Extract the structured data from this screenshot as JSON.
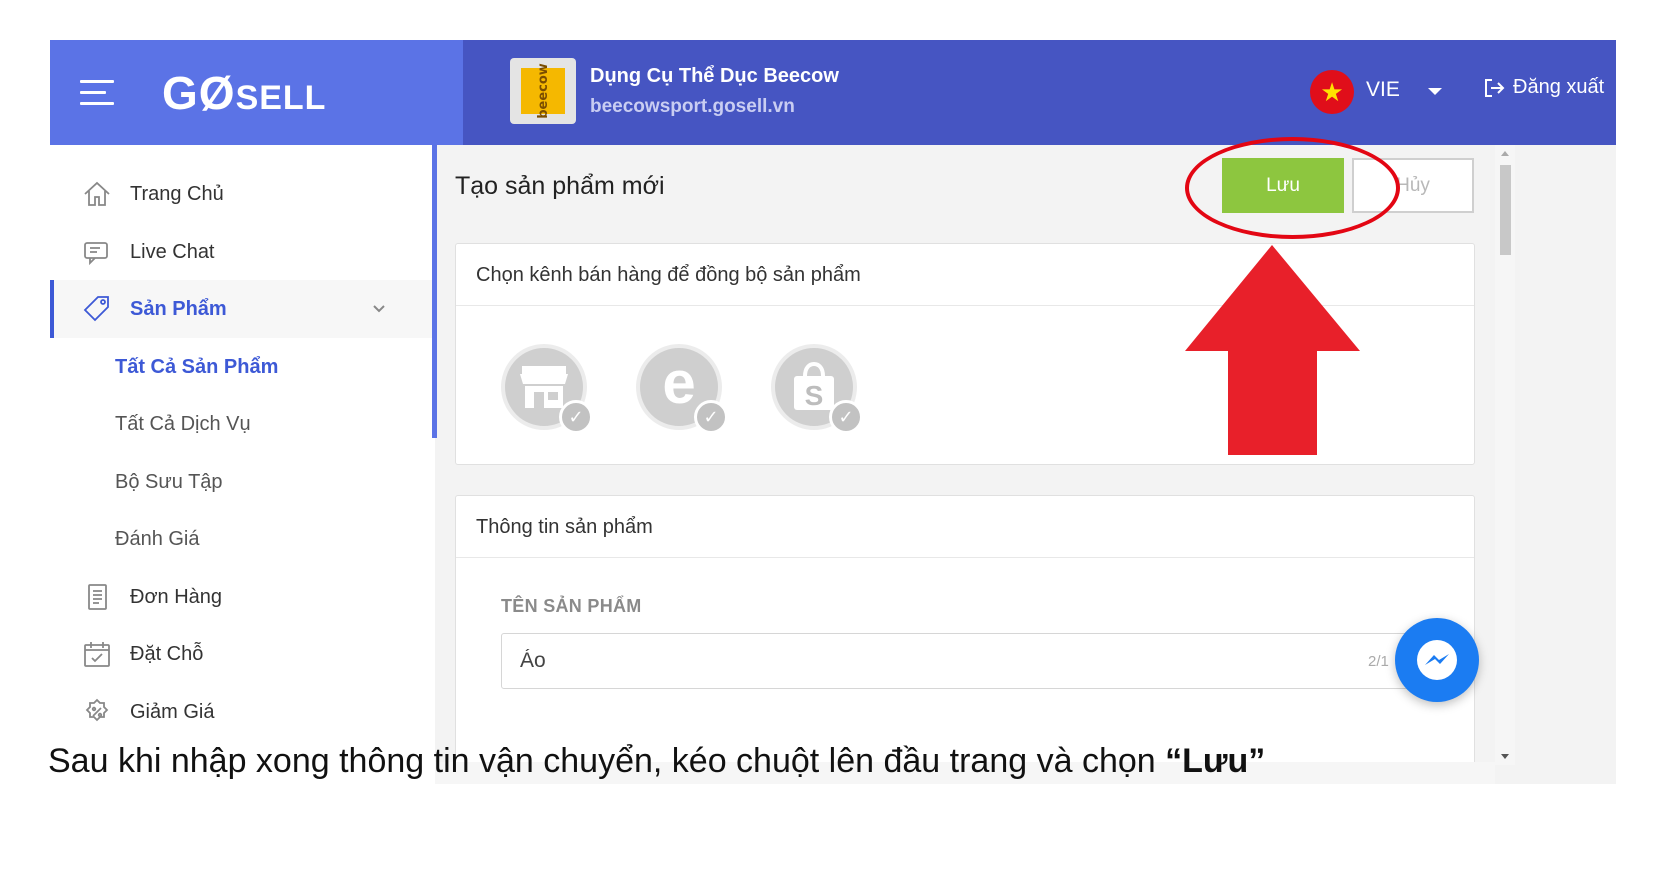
{
  "header": {
    "logo_main": "GØ",
    "logo_tail": "SELL",
    "store_thumb_text": "beecow",
    "store_name": "Dụng Cụ Thể Dục Beecow",
    "store_url": "beecowsport.gosell.vn",
    "language": "VIE",
    "logout_label": "Đăng xuất"
  },
  "sidebar": {
    "items": [
      {
        "label": "Trang Chủ",
        "icon": "home-icon"
      },
      {
        "label": "Live Chat",
        "icon": "chat-icon"
      },
      {
        "label": "Sản Phẩm",
        "icon": "tag-icon",
        "active": true
      },
      {
        "label": "Tất Cả Sản Phẩm",
        "sub": true,
        "selected": true
      },
      {
        "label": "Tất Cả Dịch Vụ",
        "sub": true
      },
      {
        "label": "Bộ Sưu Tập",
        "sub": true
      },
      {
        "label": "Đánh Giá",
        "sub": true
      },
      {
        "label": "Đơn Hàng",
        "icon": "order-icon"
      },
      {
        "label": "Đặt Chỗ",
        "icon": "calendar-icon"
      },
      {
        "label": "Giảm Giá",
        "icon": "discount-icon"
      }
    ]
  },
  "main": {
    "title": "Tạo sản phẩm mới",
    "save_label": "Lưu",
    "cancel_label": "Hủy",
    "channels_card": {
      "heading": "Chọn kênh bán hàng để đồng bộ sản phẩm",
      "channels": [
        "store-channel-icon",
        "lazada-channel-icon",
        "shopee-channel-icon"
      ],
      "shopee_letter": "S",
      "lazada_letter": "e"
    },
    "info_card": {
      "heading": "Thông tin sản phẩm",
      "name_label": "TÊN SẢN PHẨM",
      "name_value": "Áo",
      "char_count": "2/1"
    }
  },
  "caption": {
    "text": "Sau khi nhập xong thông tin vận chuyển, kéo chuột lên đầu trang và chọn ",
    "emphasis": "“Lưu”"
  },
  "colors": {
    "header_left": "#5b73e6",
    "header_right": "#4655c2",
    "save_green": "#8dc63f",
    "annotation_red": "#e30613",
    "accent_blue": "#3d59d6"
  }
}
